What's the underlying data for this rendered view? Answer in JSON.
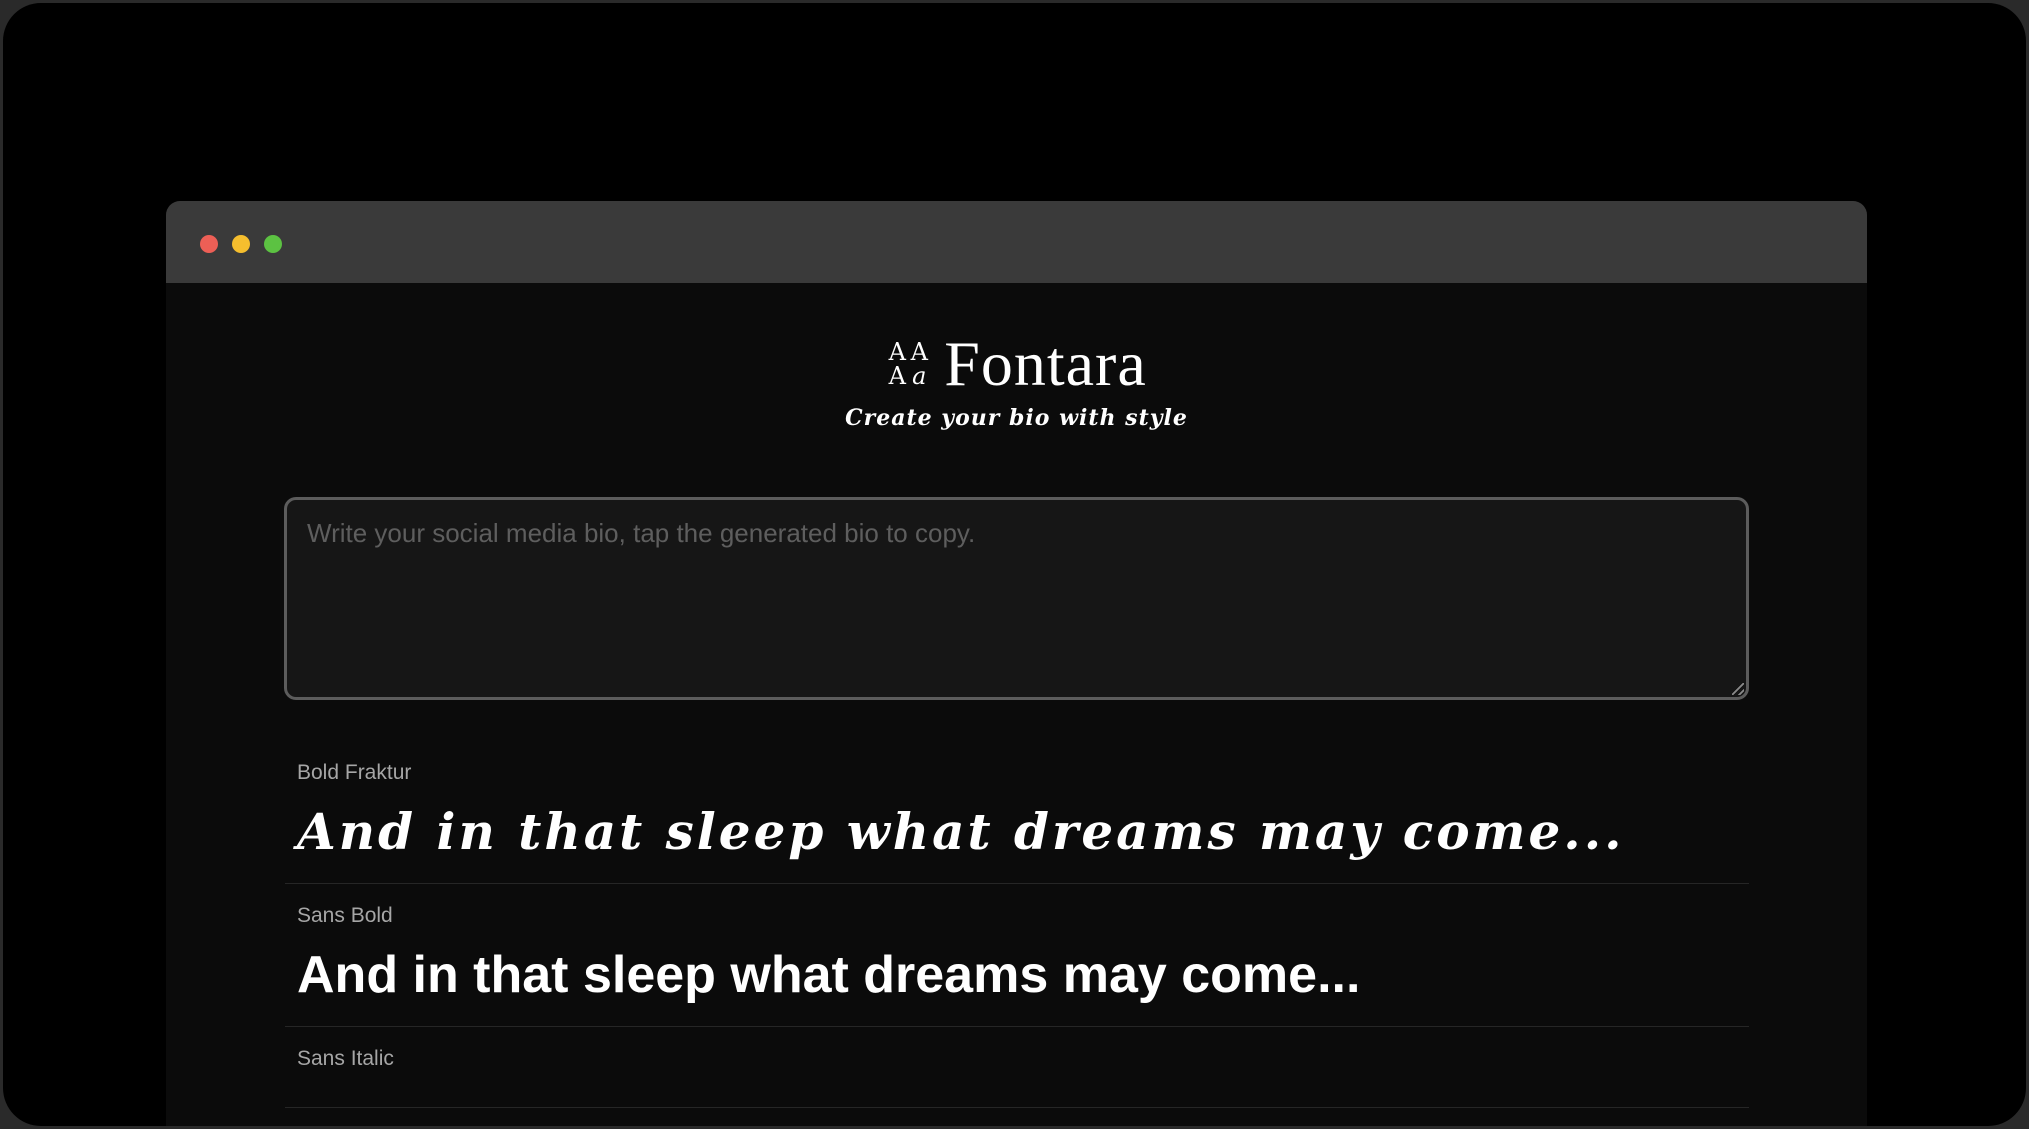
{
  "window": {
    "controls": {
      "close_color": "#ed5f56",
      "minimize_color": "#f5be2e",
      "maximize_color": "#5cc242"
    }
  },
  "header": {
    "logo_glyphs": [
      "A",
      "A",
      "A",
      "a"
    ],
    "brand_name": "Fontara",
    "tagline": "Create your bio with style"
  },
  "bio_input": {
    "value": "",
    "placeholder": "Write your social media bio, tap the generated bio to copy."
  },
  "results": [
    {
      "label": "Bold Fraktur",
      "text": "And in that sleep what dreams may come..."
    },
    {
      "label": "Sans Bold",
      "text": "And in that sleep what dreams may come..."
    },
    {
      "label": "Sans Italic",
      "text": ""
    }
  ]
}
